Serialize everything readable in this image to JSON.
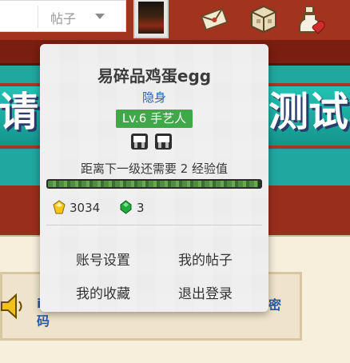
{
  "search": {
    "scope_selected": "帖子"
  },
  "banner": {
    "left_text": "请",
    "right_text": "测试"
  },
  "notice": {
    "link_fragment_top": "密",
    "link_fragment_bottom": "码",
    "link_fragment_dot": "i"
  },
  "user_menu": {
    "username": "易碎品鸡蛋egg",
    "status": "隐身",
    "level": "Lv.6 手艺人",
    "exp_text": "距离下一级还需要 2 经验值",
    "exp_progress_percent": 99,
    "gold": "3034",
    "gems": "3",
    "menu": {
      "account_settings": "账号设置",
      "my_posts": "我的帖子",
      "my_favorites": "我的收藏",
      "logout": "退出登录"
    }
  },
  "icons": [
    "chevron-down-icon",
    "avatar",
    "message-icon",
    "inventory-icon",
    "potion-icon",
    "medal-icon",
    "gold-icon",
    "gem-icon",
    "speaker-icon"
  ],
  "colors": {
    "level_badge": "#41a84a",
    "status_link": "#2f62b0",
    "banner": "#1fa7a0",
    "header": "#a2331f"
  }
}
